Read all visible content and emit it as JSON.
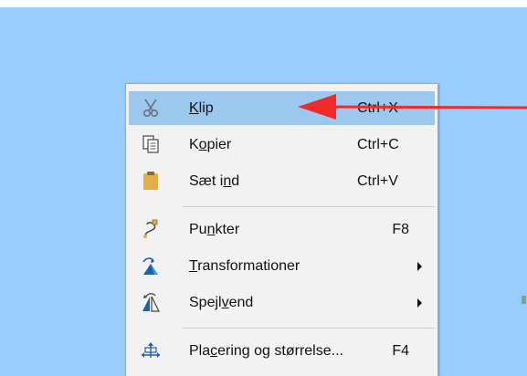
{
  "menu": {
    "items": [
      {
        "id": "cut",
        "label_before": "",
        "label_access": "K",
        "label_after": "lip",
        "shortcut": "Ctrl+X",
        "icon": "scissors-icon",
        "highlighted": true
      },
      {
        "id": "copy",
        "label_before": "K",
        "label_access": "o",
        "label_after": "pier",
        "shortcut": "Ctrl+C",
        "icon": "copy-icon"
      },
      {
        "id": "paste",
        "label_before": "Sæt i",
        "label_access": "n",
        "label_after": "d",
        "shortcut": "Ctrl+V",
        "icon": "clipboard-icon"
      },
      {
        "id": "points",
        "label_before": "Pu",
        "label_access": "n",
        "label_after": "kter",
        "shortcut": "F8",
        "icon": "bezier-points-icon"
      },
      {
        "id": "transformations",
        "label_before": "",
        "label_access": "T",
        "label_after": "ransformationer",
        "icon": "transform-icon",
        "has_submenu": true
      },
      {
        "id": "flip",
        "label_before": "Spejl",
        "label_access": "v",
        "label_after": "end",
        "icon": "flip-icon",
        "has_submenu": true
      },
      {
        "id": "position-size",
        "label_before": "Pla",
        "label_access": "c",
        "label_after": "ering og størrelse...",
        "shortcut": "F4",
        "icon": "position-size-icon"
      }
    ]
  },
  "colors": {
    "background": "#99ccff",
    "menu_bg": "#f2f2f2",
    "highlight": "#9dc8ed",
    "annotation_arrow": "#ee2a2a"
  }
}
